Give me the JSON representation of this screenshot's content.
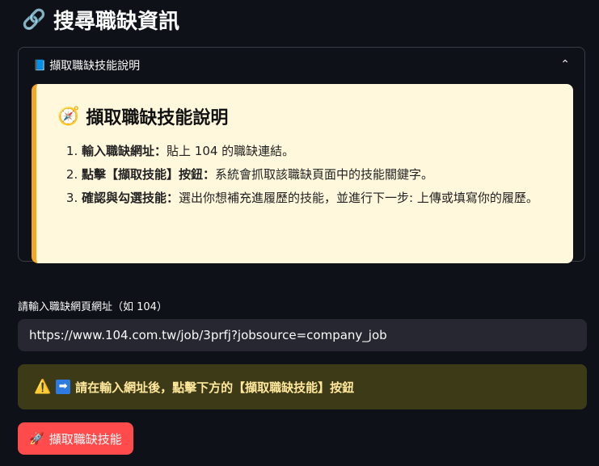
{
  "page": {
    "title": "搜尋職缺資訊",
    "title_icon": "link-icon"
  },
  "expander": {
    "header_label": "擷取職缺技能說明",
    "header_icon": "blue-book-icon",
    "card": {
      "title": "擷取職缺技能說明",
      "title_icon": "compass-icon",
      "steps": [
        {
          "bold": "輸入職缺網址：",
          "text": "貼上 104 的職缺連結。"
        },
        {
          "bold": "點擊【擷取技能】按鈕：",
          "text": "系統會抓取該職缺頁面中的技能關鍵字。"
        },
        {
          "bold": "確認與勾選技能：",
          "text": "選出你想補充進履歷的技能，並進行下一步: 上傳或填寫你的履歷。"
        }
      ]
    }
  },
  "url_field": {
    "label": "請輸入職缺網頁網址（如 104）",
    "value": "https://www.104.com.tw/job/3prfj?jobsource=company_job"
  },
  "alert": {
    "text": "請在輸入網址後，點擊下方的【擷取職缺技能】按鈕"
  },
  "action_button": {
    "label": "擷取職缺技能",
    "icon": "rocket-icon"
  },
  "colors": {
    "background": "#0e1117",
    "card_bg": "#fff8dc",
    "card_accent": "#f5a623",
    "alert_bg": "#3d3a17",
    "button_bg": "#ff4b4b"
  }
}
